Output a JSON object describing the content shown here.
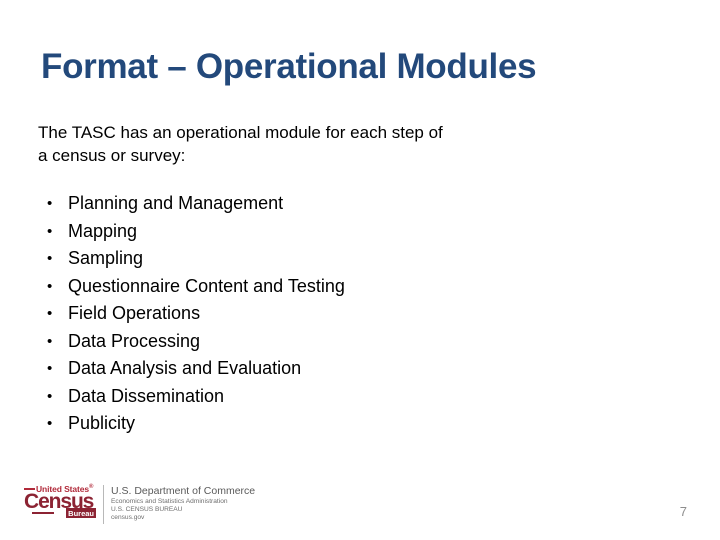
{
  "slide": {
    "title": "Format – Operational Modules",
    "intro_lines": [
      "The TASC has an operational module for each step of",
      "a census or survey:"
    ],
    "bullet_marker": "•",
    "bullets": [
      "Planning and Management",
      "Mapping",
      "Sampling",
      "Questionnaire Content and Testing",
      "Field Operations",
      "Data Processing",
      "Data Analysis and Evaluation",
      "Data Dissemination",
      "Publicity"
    ],
    "page_number": "7",
    "colors": {
      "title": "#23497B",
      "body": "#000000",
      "logo_red": "#B12A3A",
      "logo_maroon": "#8C2333",
      "page_number": "#8D8D8D",
      "background": "#FFFFFF"
    }
  },
  "footer": {
    "logo": {
      "united_states": "United States",
      "united_states_mark": "®",
      "wordmark": "Census",
      "bureau": "Bureau"
    },
    "agency": {
      "department": "U.S. Department of Commerce",
      "administration": "Economics and Statistics Administration",
      "bureau": "U.S. CENSUS BUREAU",
      "website": "census.gov"
    }
  }
}
